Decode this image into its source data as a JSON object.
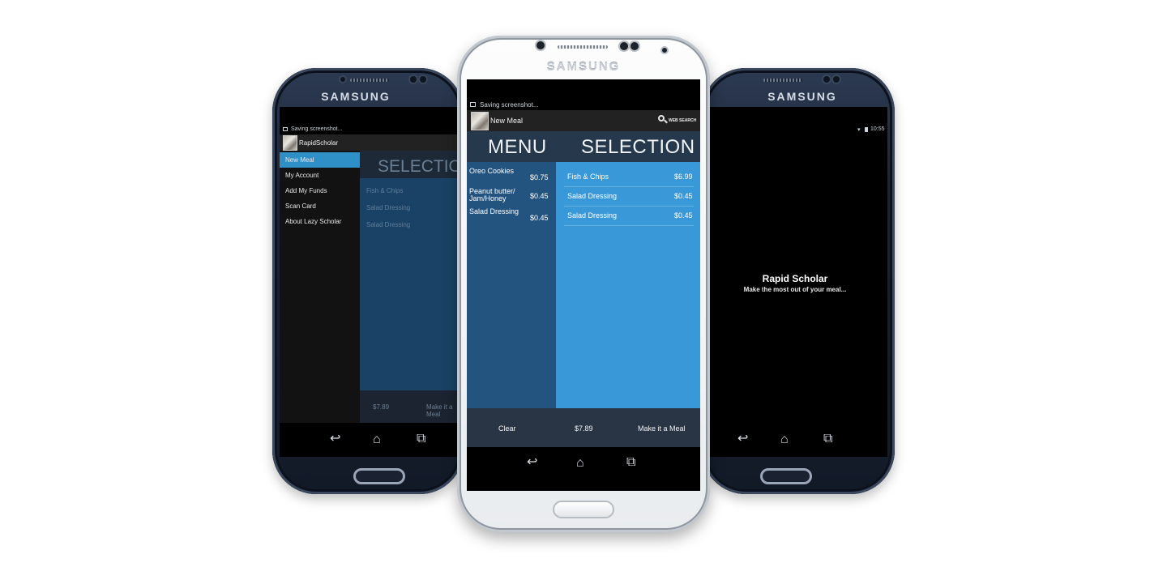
{
  "left_phone": {
    "brand": "SAMSUNG",
    "status_text": "Saving screenshot...",
    "app_title": "RapidScholar",
    "drawer_items": [
      "New Meal",
      "My Account",
      "Add My Funds",
      "Scan Card",
      "About Lazy Scholar"
    ],
    "selected_item": "New Meal",
    "bg_header": "SELECTION",
    "bg_items": [
      "Fish & Chips",
      "Salad Dressing",
      "Salad Dressing"
    ],
    "bg_total": "$7.89",
    "bg_action": "Make it a Meal"
  },
  "center_phone": {
    "brand": "SAMSUNG",
    "status_text": "Saving screenshot...",
    "app_title": "New Meal",
    "search_label": "WEB SEARCH",
    "menu_header": "MENU",
    "selection_header": "SELECTION",
    "menu_items": [
      {
        "name_line1": "Oreo Cookies",
        "name_line2": "",
        "price": "$0.75"
      },
      {
        "name_line1": "Peanut butter/",
        "name_line2": "Jam/Honey",
        "price": "$0.45"
      },
      {
        "name_line1": "Salad Dressing",
        "name_line2": "",
        "price": "$0.45"
      }
    ],
    "selection_items": [
      {
        "name": "Fish & Chips",
        "price": "$6.99"
      },
      {
        "name": "Salad Dressing",
        "price": "$0.45"
      },
      {
        "name": "Salad Dressing",
        "price": "$0.45"
      }
    ],
    "clear_label": "Clear",
    "total": "$7.89",
    "make_meal_label": "Make it a Meal"
  },
  "right_phone": {
    "brand": "SAMSUNG",
    "clock": "10:55",
    "splash_title": "Rapid Scholar",
    "splash_subtitle": "Make the most out of your meal..."
  },
  "colors": {
    "menu_column": "#23547f",
    "selection_column": "#3998d8",
    "header_band": "#26384b",
    "footer_bar": "#293444",
    "drawer_selected": "#2f8fc7"
  },
  "icons": [
    "back-icon",
    "home-icon",
    "recent-apps-icon",
    "search-icon",
    "screenshot-icon",
    "wifi-icon",
    "battery-icon"
  ]
}
